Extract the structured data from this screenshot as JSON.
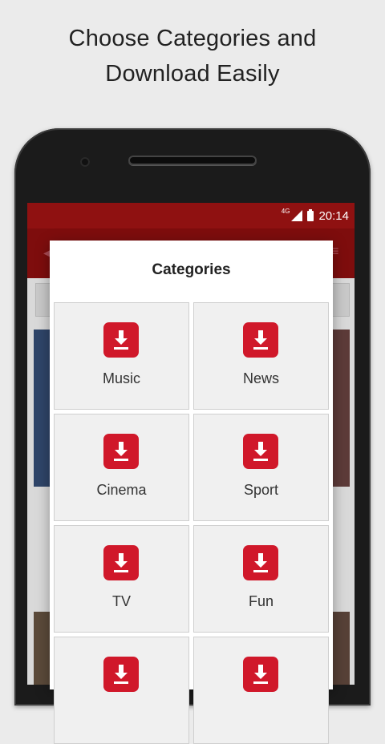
{
  "promo": {
    "headline_line1": "Choose Categories and",
    "headline_line2": "Download Easily"
  },
  "status_bar": {
    "network": "4G",
    "time": "20:14"
  },
  "dialog": {
    "title": "Categories",
    "categories": [
      {
        "label": "Music",
        "icon": "download-icon"
      },
      {
        "label": "News",
        "icon": "download-icon"
      },
      {
        "label": "Cinema",
        "icon": "download-icon"
      },
      {
        "label": "Sport",
        "icon": "download-icon"
      },
      {
        "label": "TV",
        "icon": "download-icon"
      },
      {
        "label": "Fun",
        "icon": "download-icon"
      },
      {
        "label": "",
        "icon": "download-icon"
      },
      {
        "label": "",
        "icon": "download-icon"
      }
    ]
  },
  "colors": {
    "accent": "#d0182a",
    "app_bar": "#7e0d0d",
    "status_bar": "#8f1111"
  }
}
